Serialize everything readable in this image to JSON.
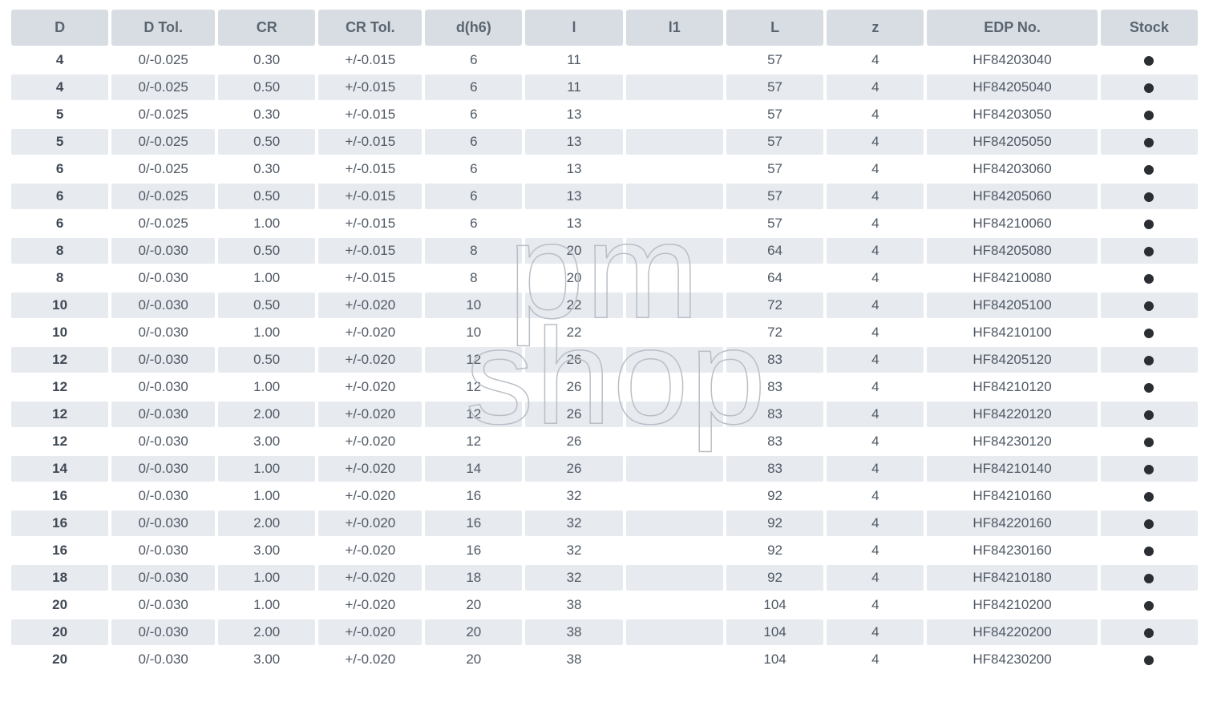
{
  "watermark": {
    "line1": "pm",
    "line2": "shop"
  },
  "headers": [
    "D",
    "D Tol.",
    "CR",
    "CR Tol.",
    "d(h6)",
    "l",
    "l1",
    "L",
    "z",
    "EDP No.",
    "Stock"
  ],
  "rows": [
    {
      "D": "4",
      "DTol": "0/-0.025",
      "CR": "0.30",
      "CRTol": "+/-0.015",
      "dh6": "6",
      "l": "11",
      "l1": "",
      "L": "57",
      "z": "4",
      "EDP": "HF84203040",
      "stock": true
    },
    {
      "D": "4",
      "DTol": "0/-0.025",
      "CR": "0.50",
      "CRTol": "+/-0.015",
      "dh6": "6",
      "l": "11",
      "l1": "",
      "L": "57",
      "z": "4",
      "EDP": "HF84205040",
      "stock": true
    },
    {
      "D": "5",
      "DTol": "0/-0.025",
      "CR": "0.30",
      "CRTol": "+/-0.015",
      "dh6": "6",
      "l": "13",
      "l1": "",
      "L": "57",
      "z": "4",
      "EDP": "HF84203050",
      "stock": true
    },
    {
      "D": "5",
      "DTol": "0/-0.025",
      "CR": "0.50",
      "CRTol": "+/-0.015",
      "dh6": "6",
      "l": "13",
      "l1": "",
      "L": "57",
      "z": "4",
      "EDP": "HF84205050",
      "stock": true
    },
    {
      "D": "6",
      "DTol": "0/-0.025",
      "CR": "0.30",
      "CRTol": "+/-0.015",
      "dh6": "6",
      "l": "13",
      "l1": "",
      "L": "57",
      "z": "4",
      "EDP": "HF84203060",
      "stock": true
    },
    {
      "D": "6",
      "DTol": "0/-0.025",
      "CR": "0.50",
      "CRTol": "+/-0.015",
      "dh6": "6",
      "l": "13",
      "l1": "",
      "L": "57",
      "z": "4",
      "EDP": "HF84205060",
      "stock": true
    },
    {
      "D": "6",
      "DTol": "0/-0.025",
      "CR": "1.00",
      "CRTol": "+/-0.015",
      "dh6": "6",
      "l": "13",
      "l1": "",
      "L": "57",
      "z": "4",
      "EDP": "HF84210060",
      "stock": true
    },
    {
      "D": "8",
      "DTol": "0/-0.030",
      "CR": "0.50",
      "CRTol": "+/-0.015",
      "dh6": "8",
      "l": "20",
      "l1": "",
      "L": "64",
      "z": "4",
      "EDP": "HF84205080",
      "stock": true
    },
    {
      "D": "8",
      "DTol": "0/-0.030",
      "CR": "1.00",
      "CRTol": "+/-0.015",
      "dh6": "8",
      "l": "20",
      "l1": "",
      "L": "64",
      "z": "4",
      "EDP": "HF84210080",
      "stock": true
    },
    {
      "D": "10",
      "DTol": "0/-0.030",
      "CR": "0.50",
      "CRTol": "+/-0.020",
      "dh6": "10",
      "l": "22",
      "l1": "",
      "L": "72",
      "z": "4",
      "EDP": "HF84205100",
      "stock": true
    },
    {
      "D": "10",
      "DTol": "0/-0.030",
      "CR": "1.00",
      "CRTol": "+/-0.020",
      "dh6": "10",
      "l": "22",
      "l1": "",
      "L": "72",
      "z": "4",
      "EDP": "HF84210100",
      "stock": true
    },
    {
      "D": "12",
      "DTol": "0/-0.030",
      "CR": "0.50",
      "CRTol": "+/-0.020",
      "dh6": "12",
      "l": "26",
      "l1": "",
      "L": "83",
      "z": "4",
      "EDP": "HF84205120",
      "stock": true
    },
    {
      "D": "12",
      "DTol": "0/-0.030",
      "CR": "1.00",
      "CRTol": "+/-0.020",
      "dh6": "12",
      "l": "26",
      "l1": "",
      "L": "83",
      "z": "4",
      "EDP": "HF84210120",
      "stock": true
    },
    {
      "D": "12",
      "DTol": "0/-0.030",
      "CR": "2.00",
      "CRTol": "+/-0.020",
      "dh6": "12",
      "l": "26",
      "l1": "",
      "L": "83",
      "z": "4",
      "EDP": "HF84220120",
      "stock": true
    },
    {
      "D": "12",
      "DTol": "0/-0.030",
      "CR": "3.00",
      "CRTol": "+/-0.020",
      "dh6": "12",
      "l": "26",
      "l1": "",
      "L": "83",
      "z": "4",
      "EDP": "HF84230120",
      "stock": true
    },
    {
      "D": "14",
      "DTol": "0/-0.030",
      "CR": "1.00",
      "CRTol": "+/-0.020",
      "dh6": "14",
      "l": "26",
      "l1": "",
      "L": "83",
      "z": "4",
      "EDP": "HF84210140",
      "stock": true
    },
    {
      "D": "16",
      "DTol": "0/-0.030",
      "CR": "1.00",
      "CRTol": "+/-0.020",
      "dh6": "16",
      "l": "32",
      "l1": "",
      "L": "92",
      "z": "4",
      "EDP": "HF84210160",
      "stock": true
    },
    {
      "D": "16",
      "DTol": "0/-0.030",
      "CR": "2.00",
      "CRTol": "+/-0.020",
      "dh6": "16",
      "l": "32",
      "l1": "",
      "L": "92",
      "z": "4",
      "EDP": "HF84220160",
      "stock": true
    },
    {
      "D": "16",
      "DTol": "0/-0.030",
      "CR": "3.00",
      "CRTol": "+/-0.020",
      "dh6": "16",
      "l": "32",
      "l1": "",
      "L": "92",
      "z": "4",
      "EDP": "HF84230160",
      "stock": true
    },
    {
      "D": "18",
      "DTol": "0/-0.030",
      "CR": "1.00",
      "CRTol": "+/-0.020",
      "dh6": "18",
      "l": "32",
      "l1": "",
      "L": "92",
      "z": "4",
      "EDP": "HF84210180",
      "stock": true
    },
    {
      "D": "20",
      "DTol": "0/-0.030",
      "CR": "1.00",
      "CRTol": "+/-0.020",
      "dh6": "20",
      "l": "38",
      "l1": "",
      "L": "104",
      "z": "4",
      "EDP": "HF84210200",
      "stock": true
    },
    {
      "D": "20",
      "DTol": "0/-0.030",
      "CR": "2.00",
      "CRTol": "+/-0.020",
      "dh6": "20",
      "l": "38",
      "l1": "",
      "L": "104",
      "z": "4",
      "EDP": "HF84220200",
      "stock": true
    },
    {
      "D": "20",
      "DTol": "0/-0.030",
      "CR": "3.00",
      "CRTol": "+/-0.020",
      "dh6": "20",
      "l": "38",
      "l1": "",
      "L": "104",
      "z": "4",
      "EDP": "HF84230200",
      "stock": true
    }
  ]
}
